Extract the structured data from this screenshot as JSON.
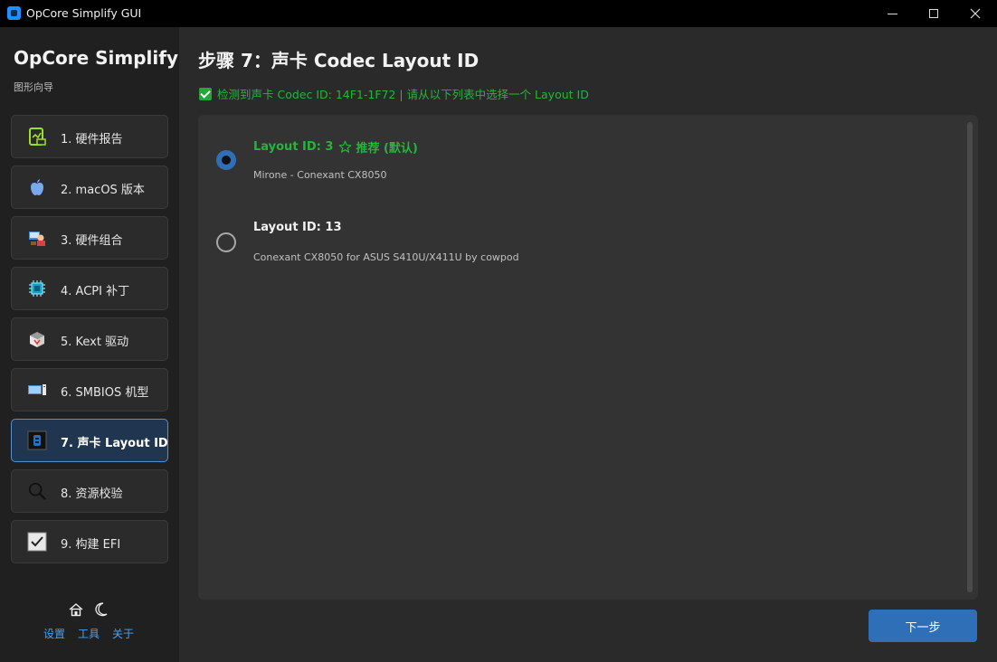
{
  "window": {
    "title": "OpCore Simplify GUI"
  },
  "sidebar": {
    "brand": "OpCore Simplify",
    "subtitle": "图形向导",
    "items": [
      {
        "label": "1. 硬件报告",
        "icon": "report-icon"
      },
      {
        "label": "2. macOS 版本",
        "icon": "apple-icon"
      },
      {
        "label": "3. 硬件组合",
        "icon": "hardware-icon"
      },
      {
        "label": "4. ACPI 补丁",
        "icon": "chip-icon"
      },
      {
        "label": "5. Kext 驱动",
        "icon": "package-icon"
      },
      {
        "label": "6. SMBIOS 机型",
        "icon": "computer-icon"
      },
      {
        "label": "7. 声卡 Layout ID",
        "icon": "sound-icon",
        "active": true
      },
      {
        "label": "8. 资源校验",
        "icon": "magnifier-icon"
      },
      {
        "label": "9. 构建 EFI",
        "icon": "checkbox-icon"
      }
    ],
    "footer": {
      "settings": "设置",
      "tools": "工具",
      "about": "关于"
    }
  },
  "main": {
    "title": "步骤 7：声卡 Codec Layout ID",
    "status": "检测到声卡 Codec ID: 14F1-1F72 | 请从以下列表中选择一个 Layout ID",
    "options": [
      {
        "title": "Layout ID: 3",
        "tag": "推荐 (默认)",
        "desc": "Mirone - Conexant CX8050",
        "selected": true
      },
      {
        "title": "Layout ID: 13",
        "desc": "Conexant CX8050 for ASUS S410U/X411U by cowpod",
        "selected": false
      }
    ],
    "next_label": "下一步"
  },
  "colors": {
    "accent": "#2f6fb8",
    "success": "#27b43b",
    "link": "#4aa0f0"
  }
}
